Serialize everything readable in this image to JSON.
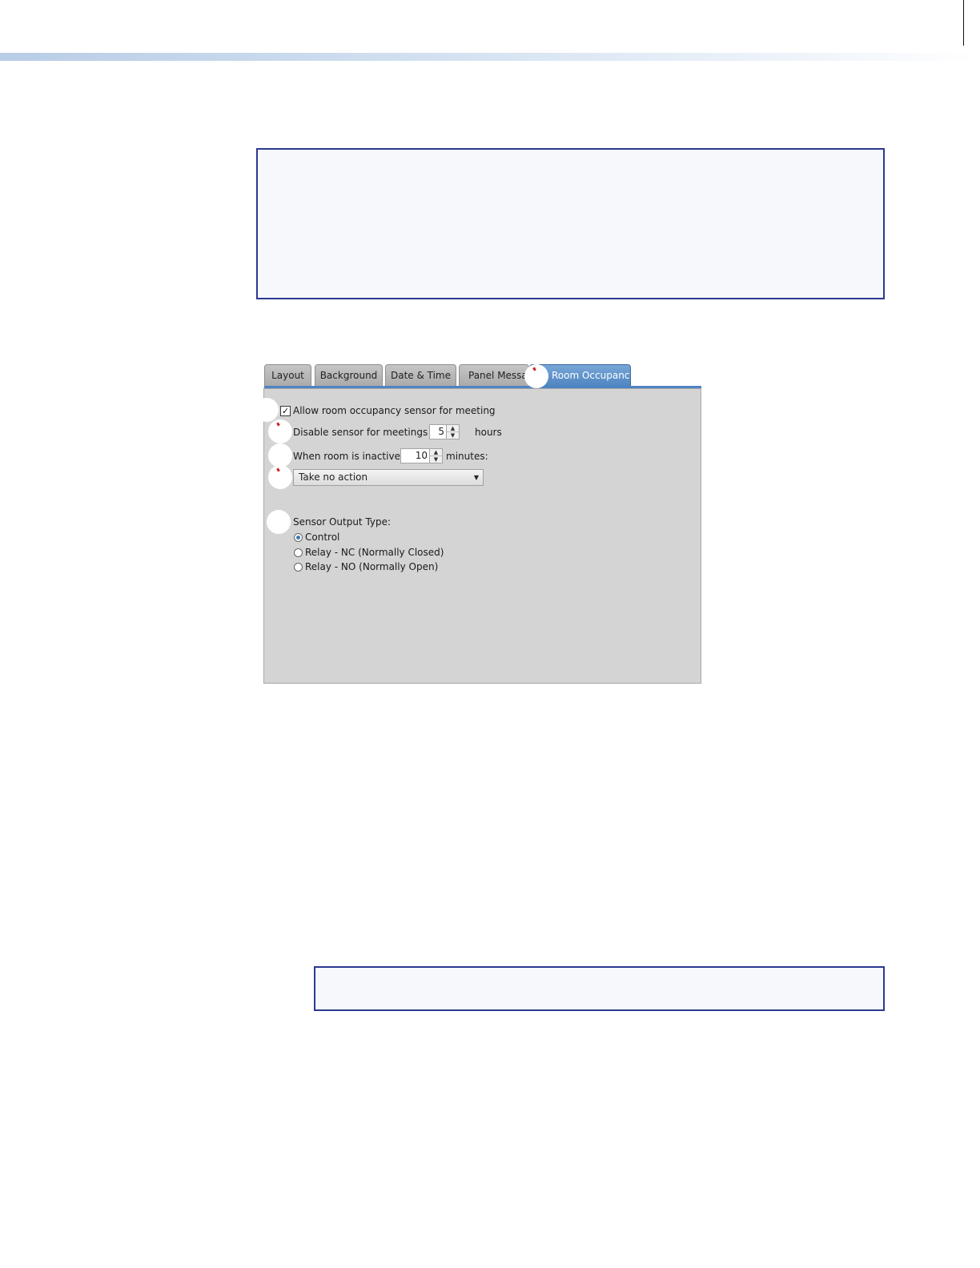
{
  "tabs": [
    {
      "label": "Layout",
      "active": false
    },
    {
      "label": "Background",
      "active": false
    },
    {
      "label": "Date & Time",
      "active": false
    },
    {
      "label": "Panel Messag",
      "active": false
    },
    {
      "label": "Room Occupancy",
      "active": true
    }
  ],
  "occupancy": {
    "allow_sensor_label": "Allow room occupancy sensor for meeting",
    "allow_sensor_checked": true,
    "disable_label": "Disable sensor for meetings over",
    "disable_hours_value": "5",
    "disable_unit": "hours",
    "inactive_label": "When room is inactive for",
    "inactive_minutes_value": "10",
    "inactive_unit": "minutes:",
    "action_selected": "Take no action",
    "output_type_label": "Sensor Output Type:",
    "output_options": [
      {
        "label": "Control",
        "selected": true
      },
      {
        "label": "Relay - NC (Normally Closed)",
        "selected": false
      },
      {
        "label": "Relay - NO (Normally Open)",
        "selected": false
      }
    ]
  },
  "colors": {
    "active_tab": "#4e84c2",
    "note_border": "#2b3990",
    "panel_bg": "#d4d4d4"
  }
}
